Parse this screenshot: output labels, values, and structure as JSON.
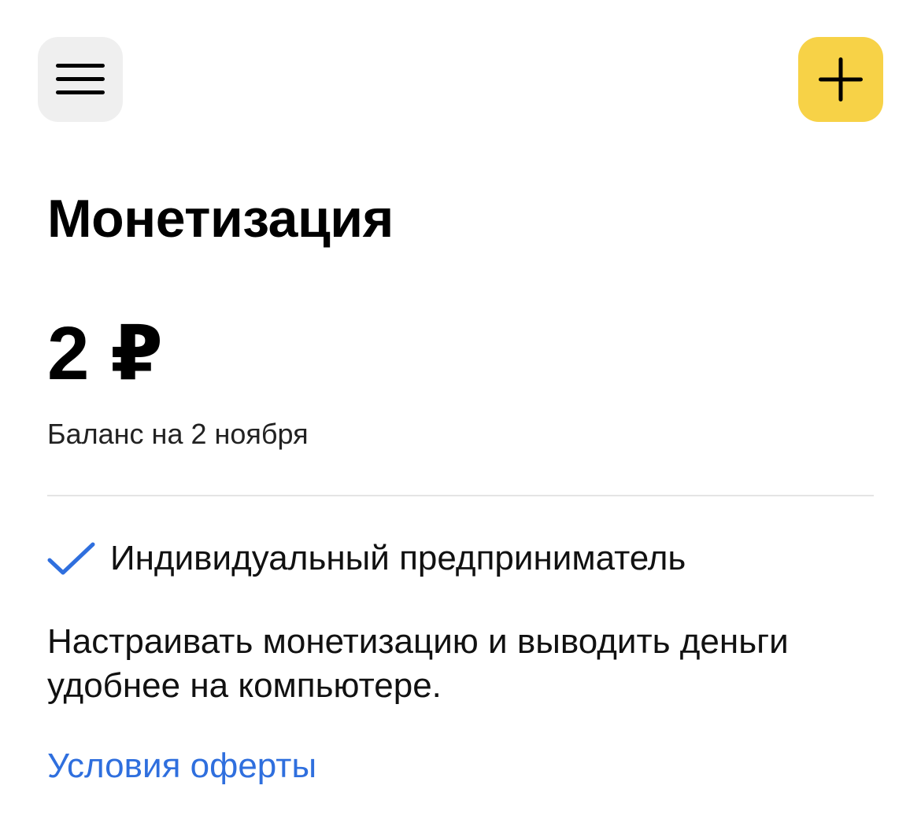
{
  "header": {
    "menu_icon": "hamburger-menu-icon",
    "add_icon": "plus-icon",
    "add_button_color": "#f7d247"
  },
  "page": {
    "title": "Монетизация"
  },
  "balance": {
    "amount": "2 ₽",
    "caption": "Баланс на 2 ноября"
  },
  "status": {
    "icon": "check-icon",
    "icon_color": "#2f6fde",
    "label": "Индивидуальный предприниматель"
  },
  "info": {
    "text": "Настраивать монетизацию и выводить деньги удобнее на компьютере."
  },
  "links": {
    "terms_label": "Условия оферты",
    "link_color": "#2f6fde"
  }
}
